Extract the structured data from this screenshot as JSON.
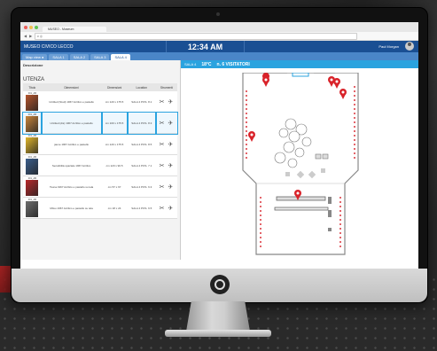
{
  "browser": {
    "tab_title": "MUSEO - Museum",
    "address": "c ◎",
    "traffic_colors": [
      "#ec5f59",
      "#f4bf4f",
      "#61c454"
    ]
  },
  "header": {
    "title": "MUSEO CIVICO LECCO",
    "clock": "12:34 AM",
    "user": "Paul Morgan"
  },
  "tabs": [
    {
      "label": "Map view ●",
      "active": false
    },
    {
      "label": "SALA 1",
      "active": false
    },
    {
      "label": "SALA 2",
      "active": false
    },
    {
      "label": "SALA 3",
      "active": false
    },
    {
      "label": "SALA 4",
      "active": true
    }
  ],
  "left_panel": {
    "description_label": "Descrizione",
    "section_title": "UTENZA",
    "columns": [
      "Titolo",
      "Dimensioni",
      "Dimensioni",
      "Location",
      "Strumenti"
    ],
    "rows": [
      {
        "code": "001_AB",
        "name": "Untitled (Stud) 1967 Acrilico e pastello",
        "dims": "cm 120 x 175.5",
        "loc": "SALA 4 POS. 8.1",
        "thumb": "#b5552d",
        "selected": false
      },
      {
        "code": "001_AB",
        "name": "Untitled (dis) 1967 Acrilico e pastello",
        "dims": "cm 100 x 175.5",
        "loc": "SALA 4 POS. 8.3",
        "thumb": "#c9853a",
        "selected": true
      },
      {
        "code": "001_AB",
        "name": "jaune 1967 Acrilico e pastello",
        "dims": "cm 120 x 175.5",
        "loc": "SALA 4 POS. 8.5",
        "thumb": "#e0b62a",
        "selected": false
      },
      {
        "code": "001_AB",
        "name": "Sensibilità spaziale 1967 Acrilico",
        "dims": "cm 120 x 90.5",
        "loc": "SALA 4 POS. 7.1",
        "thumb": "#3a5e8c",
        "selected": false
      },
      {
        "code": "001_AB",
        "name": "Tsuna 1967 Acrilico e pastello su tela",
        "dims": "cm 57 x 67",
        "loc": "SALA 4 POS. 6.3",
        "thumb": "#b8282a",
        "selected": false
      },
      {
        "code": "001_AB",
        "name": "Mitsu 1967 Acrilico e pastello su tela",
        "dims": "cm 18 x 24",
        "loc": "SALA 4 POS. 6.5",
        "thumb": "#6d6d6d",
        "selected": false
      }
    ],
    "tool_glyph": "✂ ✈"
  },
  "right_panel": {
    "room_label": "SALA 4",
    "temperature": "18°C",
    "visitors": "n. 6 VISITATORI"
  },
  "colors": {
    "header_blue": "#1a4f93",
    "accent_cyan": "#2aa3df",
    "pin_red": "#d9232a"
  }
}
